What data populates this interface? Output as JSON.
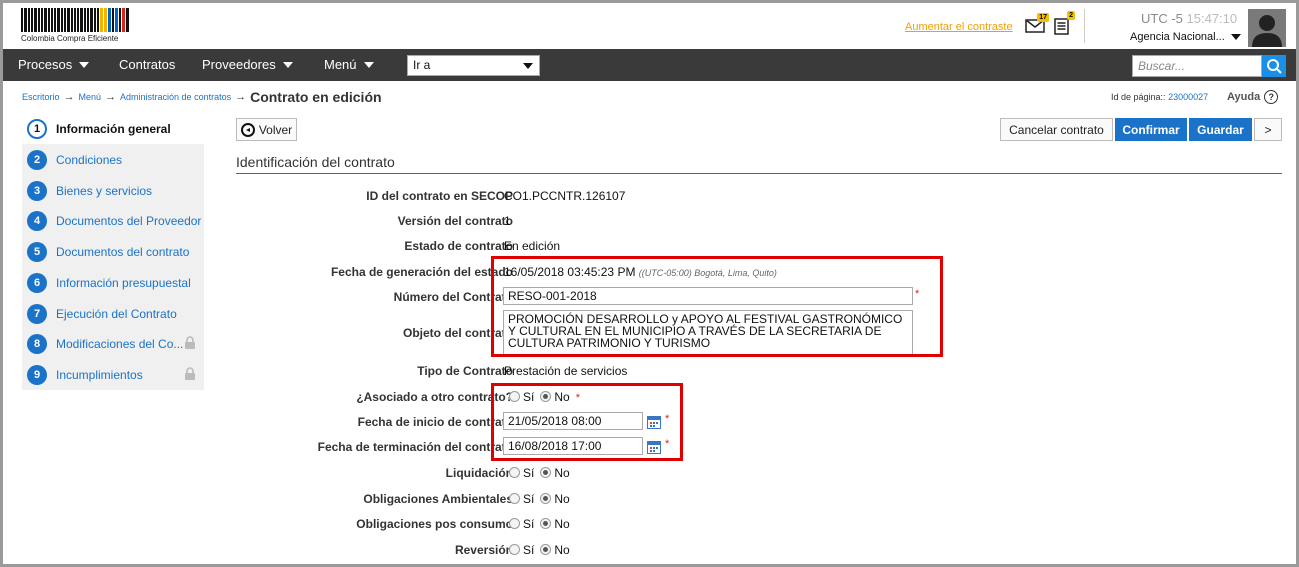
{
  "header": {
    "logo_text": "Colombia Compra Eficiente",
    "contrast_link": "Aumentar el contraste",
    "mail_count": "17",
    "news_count": "2",
    "timezone": "UTC -5",
    "time": "15:47:10",
    "agency": "Agencia Nacional..."
  },
  "nav": {
    "items": [
      "Procesos",
      "Contratos",
      "Proveedores",
      "Menú"
    ],
    "goto_value": "Ir a",
    "search_placeholder": "Buscar..."
  },
  "breadcrumb": {
    "items": [
      "Escritorio",
      "Menú",
      "Administración de contratos"
    ],
    "current": "Contrato en edición"
  },
  "page_id": {
    "label": "Id de página::",
    "value": "23000027"
  },
  "help_label": "Ayuda",
  "sidebar": {
    "steps": [
      {
        "num": "1",
        "label": "Información general"
      },
      {
        "num": "2",
        "label": "Condiciones"
      },
      {
        "num": "3",
        "label": "Bienes y servicios"
      },
      {
        "num": "4",
        "label": "Documentos del Proveedor"
      },
      {
        "num": "5",
        "label": "Documentos del contrato"
      },
      {
        "num": "6",
        "label": "Información presupuestal"
      },
      {
        "num": "7",
        "label": "Ejecución del Contrato"
      },
      {
        "num": "8",
        "label": "Modificaciones del Co..."
      },
      {
        "num": "9",
        "label": "Incumplimientos"
      }
    ]
  },
  "toolbar": {
    "back": "Volver",
    "cancel": "Cancelar contrato",
    "confirm": "Confirmar",
    "save": "Guardar",
    "next": ">"
  },
  "section_title": "Identificación del contrato",
  "fields": {
    "id_label": "ID del contrato en SECOP",
    "id_value": "CO1.PCCNTR.126107",
    "version_label": "Versión del contrato",
    "version_value": "1",
    "state_label": "Estado de contrato",
    "state_value": "En edición",
    "gen_date_label": "Fecha de generación del estado",
    "gen_date_value": "16/05/2018 03:45:23 PM",
    "gen_date_tz": "((UTC-05:00) Bogotá, Lima, Quito)",
    "number_label": "Número del Contrato",
    "number_value": "RESO-001-2018",
    "object_label": "Objeto del contrato",
    "object_value": "PROMOCIÓN DESARROLLO y APOYO AL FESTIVAL GASTRONÓMICO Y CULTURAL EN EL MUNICIPIO A TRAVÉS DE LA SECRETARIA DE CULTURA PATRIMONIO Y TURISMO",
    "type_label": "Tipo de Contrato",
    "type_value": "Prestación de servicios",
    "assoc_label": "¿Asociado a otro contrato?",
    "start_label": "Fecha de inicio de contrato",
    "start_value": "21/05/2018 08:00",
    "end_label": "Fecha de terminación del contrato",
    "end_value": "16/08/2018 17:00",
    "liq_label": "Liquidación",
    "env_label": "Obligaciones Ambientales",
    "post_label": "Obligaciones pos consumo",
    "rev_label": "Reversión",
    "yes": "Sí",
    "no": "No",
    "required_mark": "*"
  }
}
